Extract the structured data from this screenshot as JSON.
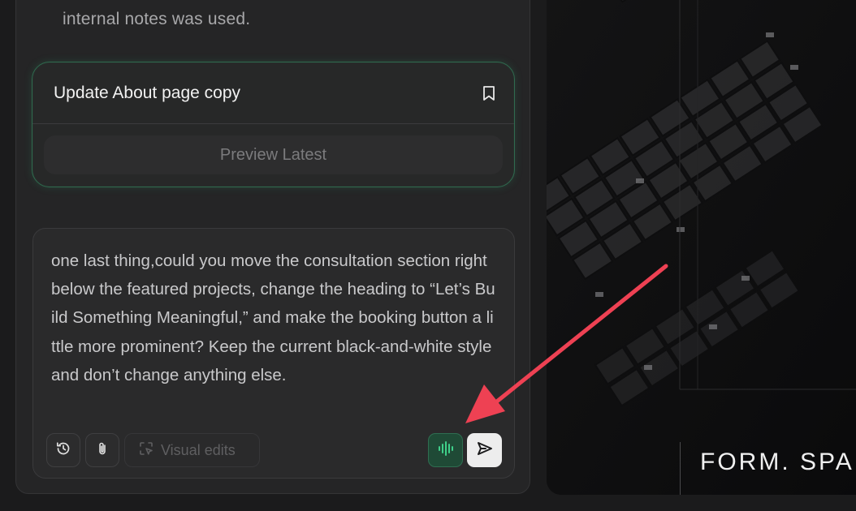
{
  "chat": {
    "previous_message_tail": "internal notes was used.",
    "update_card": {
      "title": "Update About page copy",
      "bookmark_icon": "bookmark-icon",
      "preview_button_label": "Preview Latest"
    },
    "composer": {
      "text": "one last thing,could you move the consultation section right below the featured projects, change the heading to “Let’s Build Something Meaningful,” and make the booking button a little more prominent? Keep the current black-and-white style and don’t change anything else.",
      "history_icon": "history-icon",
      "attach_icon": "paperclip-icon",
      "visual_edits_label": "Visual edits",
      "visual_edits_icon": "visual-edits-icon",
      "voice_icon": "audio-waveform-icon",
      "send_icon": "send-icon"
    }
  },
  "preview": {
    "hero_text": "FORM. SPA"
  },
  "colors": {
    "accent_green": "#2f6e51",
    "annotation_arrow": "#ee4153"
  }
}
